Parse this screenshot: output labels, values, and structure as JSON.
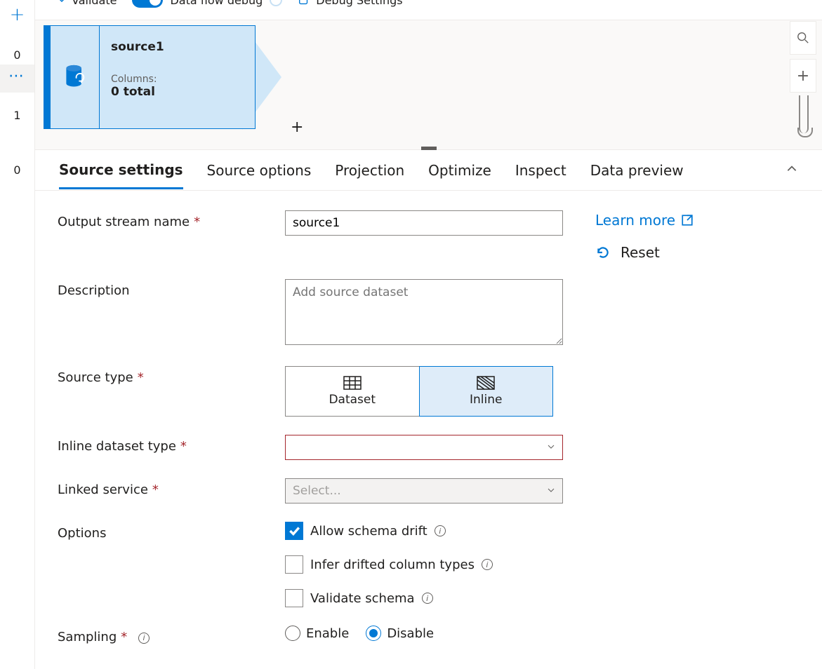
{
  "toolbar": {
    "validate": "Validate",
    "debug_toggle_label": "Data flow debug",
    "debug_toggle_on": true,
    "debug_settings": "Debug Settings"
  },
  "leftrail": {
    "items": [
      "0",
      "1",
      "0"
    ]
  },
  "node": {
    "title": "source1",
    "columns_label": "Columns:",
    "columns_value": "0 total"
  },
  "tabs": {
    "items": [
      "Source settings",
      "Source options",
      "Projection",
      "Optimize",
      "Inspect",
      "Data preview"
    ],
    "active_index": 0
  },
  "form": {
    "output_stream_label": "Output stream name",
    "output_stream_value": "source1",
    "learn_more": "Learn more",
    "reset": "Reset",
    "description_label": "Description",
    "description_placeholder": "Add source dataset",
    "description_value": "",
    "source_type_label": "Source type",
    "source_type_options": [
      "Dataset",
      "Inline"
    ],
    "source_type_selected": "Inline",
    "inline_type_label": "Inline dataset type",
    "inline_type_value": "",
    "linked_service_label": "Linked service",
    "linked_service_placeholder": "Select...",
    "options_label": "Options",
    "opt_allow_drift": "Allow schema drift",
    "opt_allow_drift_checked": true,
    "opt_infer": "Infer drifted column types",
    "opt_infer_checked": false,
    "opt_validate": "Validate schema",
    "opt_validate_checked": false,
    "sampling_label": "Sampling",
    "sampling_options": [
      "Enable",
      "Disable"
    ],
    "sampling_selected": "Disable"
  }
}
